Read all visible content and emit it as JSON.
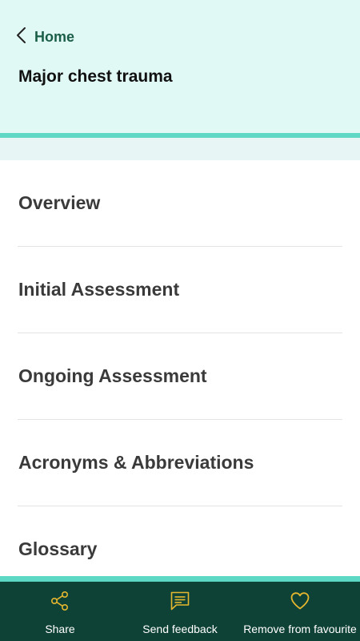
{
  "header": {
    "back_label": "Home",
    "title": "Major chest trauma"
  },
  "sections": [
    {
      "label": "Overview"
    },
    {
      "label": "Initial Assessment"
    },
    {
      "label": "Ongoing Assessment"
    },
    {
      "label": "Acronyms & Abbreviations"
    },
    {
      "label": "Glossary"
    }
  ],
  "bottom_bar": {
    "share_label": "Share",
    "feedback_label": "Send feedback",
    "favourite_label": "Remove from favourite"
  },
  "colors": {
    "header_bg": "#e0f9f5",
    "accent": "#5dd8c4",
    "bar_bg": "#0f4236",
    "icon_gold": "#e5b72e",
    "back_text": "#1b5e48"
  },
  "icons": {
    "back": "chevron-left-icon",
    "share": "share-icon",
    "feedback": "chat-bubble-icon",
    "favourite": "heart-icon"
  }
}
